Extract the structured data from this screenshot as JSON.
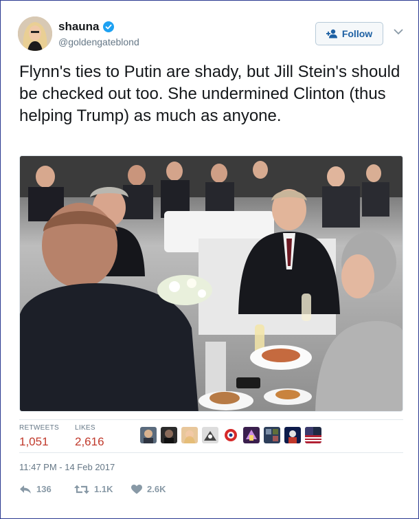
{
  "user": {
    "display_name": "shauna",
    "handle": "@goldengateblond",
    "verified": true
  },
  "follow_button": {
    "label": "Follow"
  },
  "tweet": {
    "text": "Flynn's ties to Putin are shady, but Jill Stein's should be checked out too. She undermined Clinton (thus helping Trump) as much as anyone."
  },
  "stats": {
    "retweets_label": "RETWEETS",
    "retweets_value": "1,051",
    "likes_label": "LIKES",
    "likes_value": "2,616"
  },
  "timestamp": "11:47 PM - 14 Feb 2017",
  "actions": {
    "reply_count": "136",
    "retweet_count": "1.1K",
    "like_count": "2.6K"
  },
  "colors": {
    "accent": "#1d60a3",
    "verified": "#1da1f2",
    "stat_value": "#c0392b",
    "muted": "#657786",
    "frame": "#2b3990"
  }
}
